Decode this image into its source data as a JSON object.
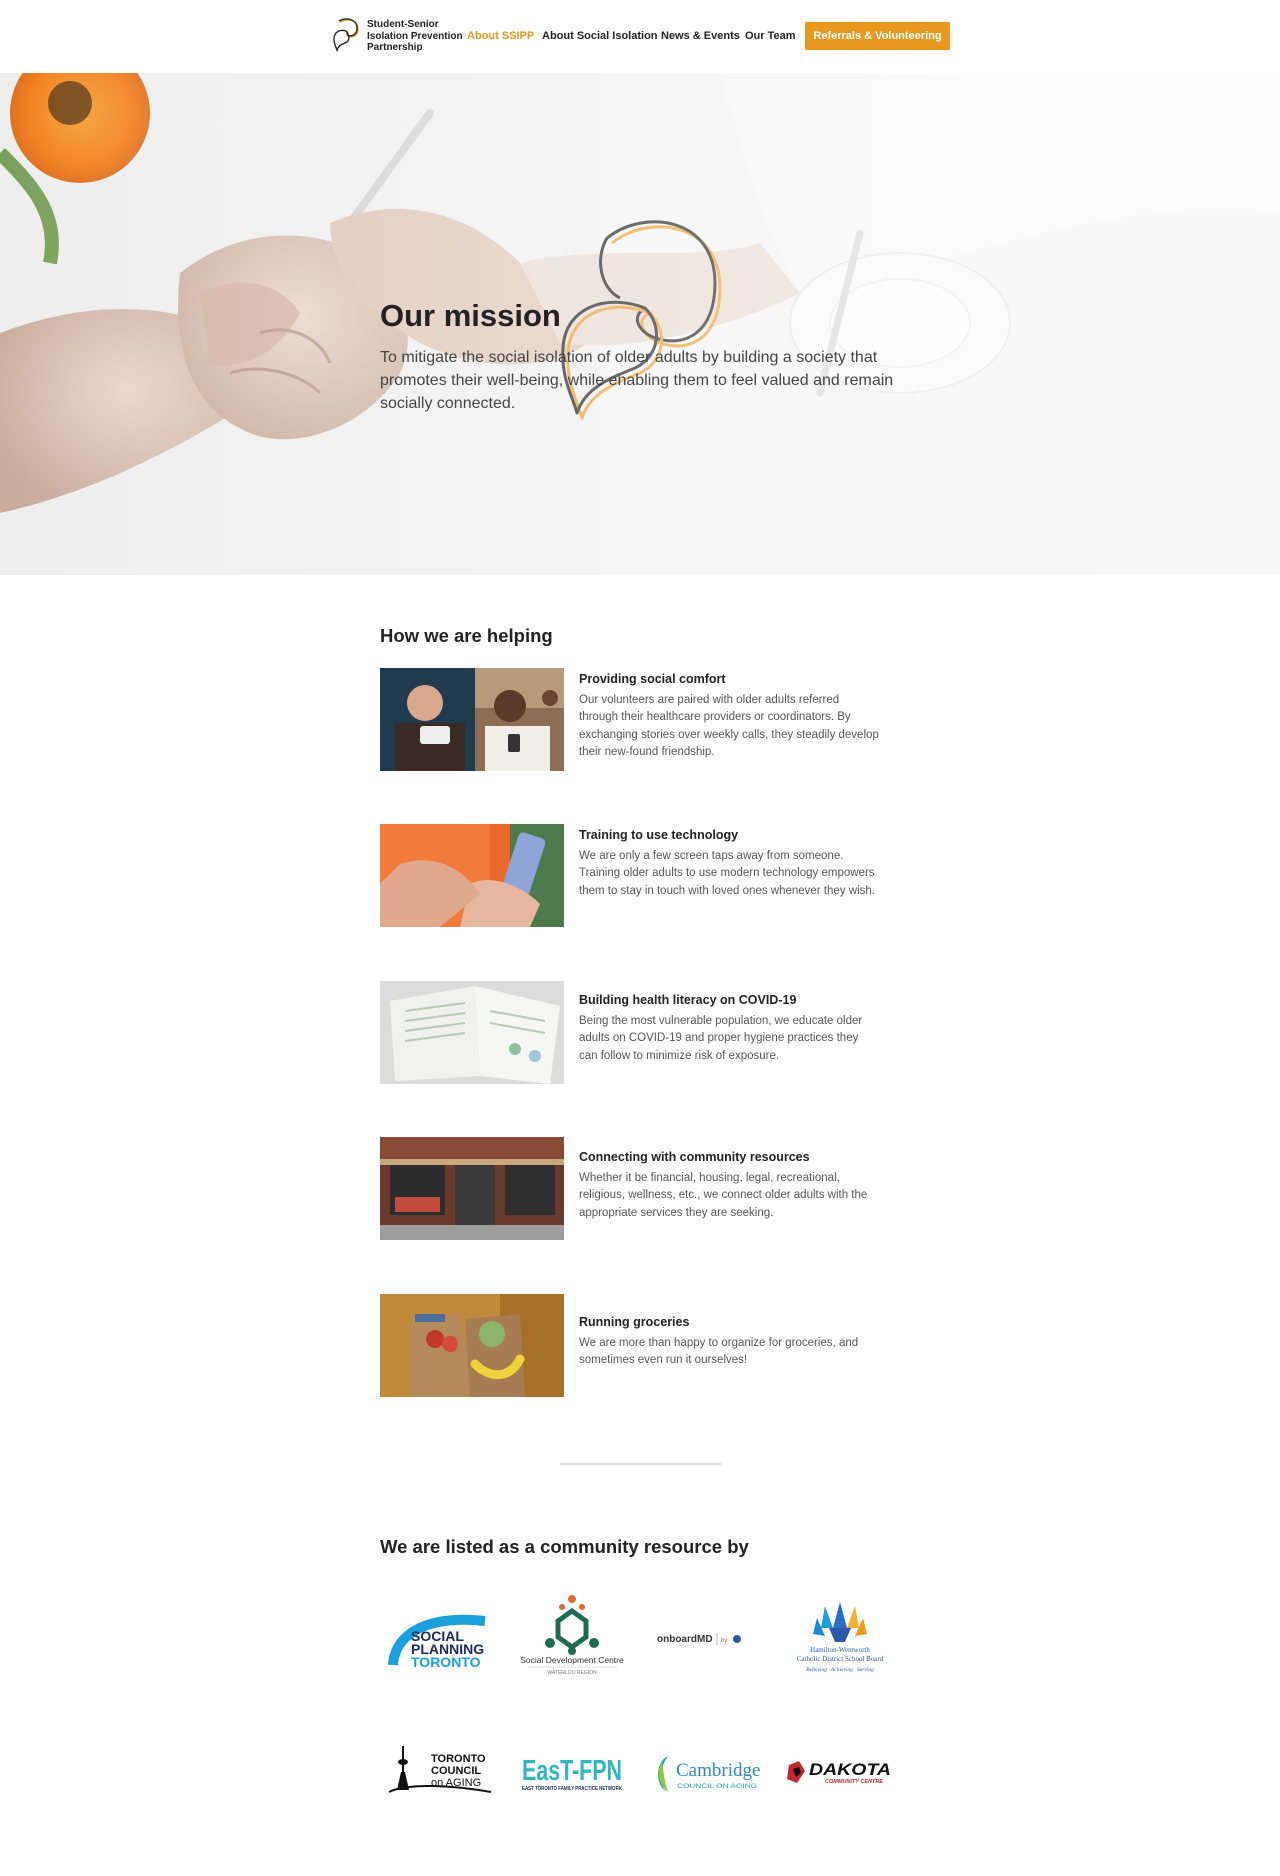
{
  "header": {
    "brand_lines": [
      "Student-Senior",
      "Isolation Prevention",
      "Partnership"
    ],
    "nav": [
      {
        "label": "About SSIPP",
        "active": true
      },
      {
        "label": "About Social Isolation",
        "active": false
      },
      {
        "label": "News & Events",
        "active": false
      },
      {
        "label": "Our Team",
        "active": false
      }
    ],
    "cta_label": "Referrals & Volunteering"
  },
  "hero": {
    "title": "Our mission",
    "text": "To mitigate the social isolation of older adults by building a society that promotes their well-being, while enabling them to feel valued and remain socially connected."
  },
  "helping": {
    "title": "How we are helping",
    "items": [
      {
        "title": "Providing social comfort",
        "text": "Our volunteers are paired with older adults referred through their healthcare providers or coordinators. By exchanging stories over weekly calls, they steadily develop their new-found friendship."
      },
      {
        "title": "Training to use technology",
        "text": "We are only a few screen taps away from someone. Training older adults to use modern technology empowers them to stay in touch with loved ones whenever they wish."
      },
      {
        "title": "Building health literacy on COVID-19",
        "text": "Being the most vulnerable population, we educate older adults on COVID-19 and proper hygiene practices they can follow to minimize risk of exposure."
      },
      {
        "title": "Connecting with community resources",
        "text": "Whether it be financial, housing, legal, recreational, religious, wellness, etc., we connect older adults with the appropriate services they are seeking."
      },
      {
        "title": "Running groceries",
        "text": "We are more than happy to organize for groceries, and sometimes even run it ourselves!"
      }
    ]
  },
  "partners": {
    "title": "We are listed as a community resource by",
    "logos": {
      "spt": [
        "SOCIAL",
        "PLANNING",
        "TORONTO"
      ],
      "sdc": [
        "Social Development Centre",
        "WATERLOO REGION"
      ],
      "onboard": [
        "onboardMD",
        "by"
      ],
      "hwcdsb": [
        "Hamilton-Wentworth",
        "Catholic District School Board",
        "Believing · Achieving · Serving"
      ],
      "tcoa": [
        "TORONTO",
        "COUNCIL",
        "on AGING"
      ],
      "east": [
        "EasT-FPN",
        "EAST TORONTO FAMILY PRACTICE NETWORK"
      ],
      "cambridge": [
        "Cambridge",
        "COUNCIL ON AGING"
      ],
      "dakota": [
        "DAKOTA",
        "COMMUNITY CENTRE"
      ]
    }
  },
  "colors": {
    "accent": "#e8971f",
    "text": "#222222",
    "muted": "#555555"
  }
}
